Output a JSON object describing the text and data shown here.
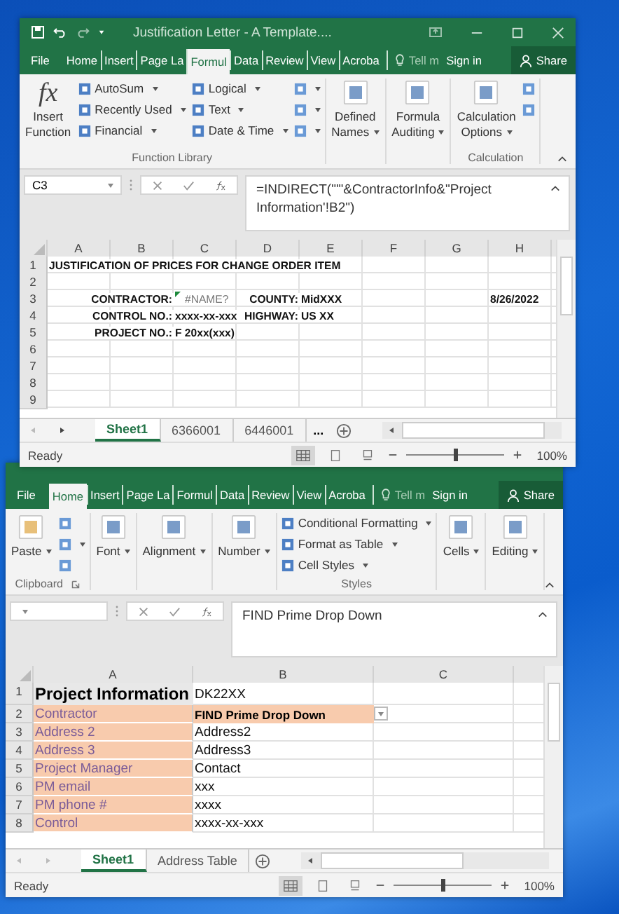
{
  "windows": [
    {
      "title": "Justification Letter - A Template....",
      "tabs": [
        {
          "label": "File",
          "selected": false
        },
        {
          "label": "Home",
          "selected": false
        },
        {
          "label": "Insert",
          "selected": false
        },
        {
          "label": "Page La",
          "selected": false
        },
        {
          "label": "Formul",
          "selected": true
        },
        {
          "label": "Data",
          "selected": false
        },
        {
          "label": "Review",
          "selected": false
        },
        {
          "label": "View",
          "selected": false
        },
        {
          "label": "Acroba",
          "selected": false
        }
      ],
      "tell_me": "Tell m",
      "sign_in": "Sign in",
      "share": "Share",
      "ribbon": [
        {
          "label": "Function Library",
          "launcher": false,
          "items": [
            {
              "kind": "large",
              "glyph": "fx",
              "lines": [
                "Insert",
                "Function"
              ],
              "dropdown": false
            },
            {
              "kind": "stack",
              "entries": [
                {
                  "text": "AutoSum",
                  "dropdown": true
                },
                {
                  "text": "Recently Used",
                  "dropdown": true
                },
                {
                  "text": "Financial",
                  "dropdown": true
                }
              ]
            },
            {
              "kind": "stack",
              "entries": [
                {
                  "text": "Logical",
                  "dropdown": true
                },
                {
                  "text": "Text",
                  "dropdown": true
                },
                {
                  "text": "Date & Time",
                  "dropdown": true
                }
              ]
            },
            {
              "kind": "stack",
              "entries": [
                {
                  "dropdown": true
                },
                {
                  "dropdown": true
                },
                {
                  "dropdown": true
                }
              ]
            }
          ]
        },
        {
          "items": [
            {
              "kind": "large",
              "lines": [
                "Defined",
                "Names"
              ],
              "dropdown": true
            }
          ]
        },
        {
          "items": [
            {
              "kind": "large",
              "lines": [
                "Formula",
                "Auditing"
              ],
              "dropdown": true
            }
          ]
        },
        {
          "label": "Calculation",
          "launcher": false,
          "items": [
            {
              "kind": "large",
              "lines": [
                "Calculation",
                "Options"
              ],
              "dropdown": true
            },
            {
              "kind": "stack",
              "entries": [
                {
                  "dropdown": false
                },
                {
                  "dropdown": false
                }
              ]
            }
          ]
        }
      ],
      "name_box": "C3",
      "formula": "=INDIRECT(\"'\"&ContractorInfo&\"Project Information'!B2\")",
      "columns": [
        "A",
        "B",
        "C",
        "D",
        "E",
        "F",
        "G",
        "H"
      ],
      "rows": [
        {
          "number": "1",
          "cells": [
            {
              "kind": "title",
              "text": "JUSTIFICATION OF PRICES FOR CHANGE ORDER ITEM"
            },
            {},
            {},
            {},
            {},
            {},
            {},
            {}
          ]
        },
        {
          "number": "2",
          "cells": [
            {},
            {},
            {},
            {},
            {},
            {},
            {},
            {}
          ]
        },
        {
          "number": "3",
          "cells": [
            {},
            {
              "kind": "label",
              "text": "CONTRACTOR:"
            },
            {
              "kind": "error",
              "text": "#NAME?"
            },
            {
              "kind": "label",
              "text": "COUNTY:"
            },
            {
              "kind": "value",
              "text": "MidXXX"
            },
            {},
            {},
            {
              "kind": "value",
              "text": "8/26/2022"
            }
          ]
        },
        {
          "number": "4",
          "cells": [
            {},
            {
              "kind": "label",
              "text": "CONTROL NO.:"
            },
            {
              "kind": "value",
              "text": "xxxx-xx-xxx"
            },
            {
              "kind": "label",
              "text": "HIGHWAY:"
            },
            {
              "kind": "value",
              "text": "US XX"
            },
            {},
            {},
            {}
          ]
        },
        {
          "number": "5",
          "cells": [
            {},
            {
              "kind": "label",
              "text": "PROJECT NO.:"
            },
            {
              "kind": "value",
              "text": "F 20xx(xxx)"
            },
            {},
            {},
            {},
            {},
            {}
          ]
        },
        {
          "number": "6",
          "cells": [
            {},
            {},
            {},
            {},
            {},
            {},
            {},
            {}
          ]
        },
        {
          "number": "7",
          "cells": [
            {},
            {},
            {},
            {},
            {},
            {},
            {},
            {}
          ]
        },
        {
          "number": "8",
          "cells": [
            {},
            {},
            {},
            {},
            {},
            {},
            {},
            {}
          ]
        },
        {
          "number": "9",
          "cells": [
            {},
            {},
            {},
            {},
            {},
            {},
            {},
            {}
          ]
        }
      ],
      "sheet_tabs": [
        {
          "label": "Sheet1",
          "selected": true
        },
        {
          "label": "6366001",
          "selected": false
        },
        {
          "label": "6446001",
          "selected": false
        }
      ],
      "more_sheets": "...",
      "status": "Ready",
      "zoom": {
        "level": 0.5,
        "reading": "100%"
      }
    },
    {
      "tabs": [
        {
          "label": "File",
          "selected": false
        },
        {
          "label": "Home",
          "selected": true
        },
        {
          "label": "Insert",
          "selected": false
        },
        {
          "label": "Page La",
          "selected": false
        },
        {
          "label": "Formul",
          "selected": false
        },
        {
          "label": "Data",
          "selected": false
        },
        {
          "label": "Review",
          "selected": false
        },
        {
          "label": "View",
          "selected": false
        },
        {
          "label": "Acroba",
          "selected": false
        }
      ],
      "tell_me": "Tell m",
      "sign_in": "Sign in",
      "share": "Share",
      "ribbon": [
        {
          "label": "Clipboard",
          "launcher": true,
          "items": [
            {
              "kind": "large",
              "lines": [
                "Paste"
              ],
              "dropdown": true
            },
            {
              "kind": "stack",
              "entries": [
                {
                  "dropdown": false
                },
                {
                  "dropdown": true
                },
                {
                  "dropdown": false
                }
              ]
            }
          ]
        },
        {
          "items": [
            {
              "kind": "large",
              "lines": [
                "Font"
              ],
              "dropdown": true
            }
          ]
        },
        {
          "items": [
            {
              "kind": "large",
              "lines": [
                "Alignment"
              ],
              "dropdown": true
            }
          ]
        },
        {
          "items": [
            {
              "kind": "large",
              "lines": [
                "Number"
              ],
              "dropdown": true
            }
          ]
        },
        {
          "label": "Styles",
          "launcher": false,
          "items": [
            {
              "kind": "stack",
              "entries": [
                {
                  "text": "Conditional Formatting",
                  "dropdown": true
                },
                {
                  "text": "Format as Table",
                  "dropdown": true
                },
                {
                  "text": "Cell Styles",
                  "dropdown": true
                }
              ]
            }
          ]
        },
        {
          "items": [
            {
              "kind": "large",
              "lines": [
                "Cells"
              ],
              "dropdown": true
            }
          ]
        },
        {
          "items": [
            {
              "kind": "large",
              "lines": [
                "Editing"
              ],
              "dropdown": true
            }
          ]
        }
      ],
      "formula": "FIND Prime Drop Down",
      "columns": [
        "A",
        "B",
        "C"
      ],
      "rows": [
        {
          "number": "1",
          "cells": [
            {
              "kind": "heading",
              "text": "Project Information"
            },
            {
              "kind": "text",
              "text": "DK22XX"
            },
            {}
          ]
        },
        {
          "number": "2",
          "cells": [
            {
              "kind": "field",
              "text": "Contractor"
            },
            {
              "kind": "picked",
              "text": "FIND Prime Drop Down"
            },
            {}
          ]
        },
        {
          "number": "3",
          "cells": [
            {
              "kind": "field",
              "text": "Address 2"
            },
            {
              "kind": "text",
              "text": "Address2"
            },
            {}
          ]
        },
        {
          "number": "4",
          "cells": [
            {
              "kind": "field",
              "text": "Address 3"
            },
            {
              "kind": "text",
              "text": "Address3"
            },
            {}
          ]
        },
        {
          "number": "5",
          "cells": [
            {
              "kind": "field",
              "text": "Project Manager"
            },
            {
              "kind": "text",
              "text": "Contact"
            },
            {}
          ]
        },
        {
          "number": "6",
          "cells": [
            {
              "kind": "field",
              "text": "PM email"
            },
            {
              "kind": "text",
              "text": "xxx"
            },
            {}
          ]
        },
        {
          "number": "7",
          "cells": [
            {
              "kind": "field",
              "text": "PM phone #"
            },
            {
              "kind": "text",
              "text": "xxxx"
            },
            {}
          ]
        },
        {
          "number": "8",
          "cells": [
            {
              "kind": "field",
              "text": "Control"
            },
            {
              "kind": "text",
              "text": "xxxx-xx-xxx"
            },
            {}
          ]
        }
      ],
      "sheet_tabs": [
        {
          "label": "Sheet1",
          "selected": true
        },
        {
          "label": "Address Table",
          "selected": false
        }
      ],
      "status": "Ready",
      "zoom": {
        "level": 0.5,
        "reading": "100%"
      }
    }
  ]
}
